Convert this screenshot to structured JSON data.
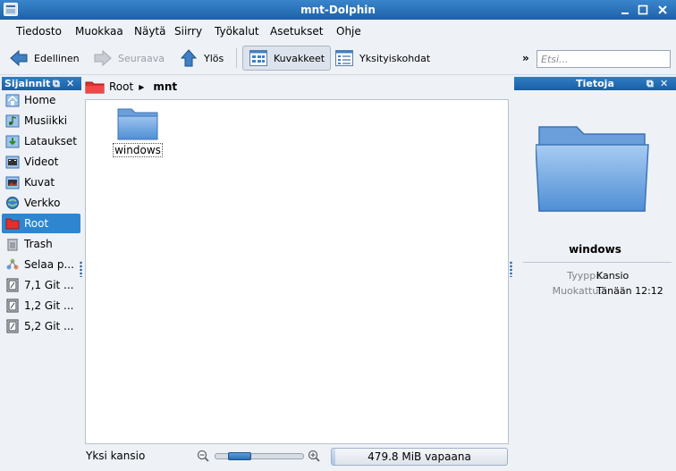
{
  "window": {
    "title": "mnt-Dolphin"
  },
  "menu": [
    "Tiedosto",
    "Muokkaa",
    "Näytä",
    "Siirry",
    "Työkalut",
    "Asetukset",
    "Ohje"
  ],
  "toolbar": {
    "back": "Edellinen",
    "forward": "Seuraava",
    "up": "Ylös",
    "icons_view": "Kuvakkeet",
    "details_view": "Yksityiskohdat",
    "more": "»",
    "search_placeholder": "Etsi..."
  },
  "places": {
    "title": "Sijainnit",
    "items": [
      {
        "label": "Home",
        "icon": "home-icon"
      },
      {
        "label": "Musiikki",
        "icon": "music-icon"
      },
      {
        "label": "Lataukset",
        "icon": "downloads-icon"
      },
      {
        "label": "Videot",
        "icon": "videos-icon"
      },
      {
        "label": "Kuvat",
        "icon": "pictures-icon"
      },
      {
        "label": "Verkko",
        "icon": "network-icon"
      },
      {
        "label": "Root",
        "icon": "root-folder-icon",
        "selected": true
      },
      {
        "label": "Trash",
        "icon": "trash-icon"
      },
      {
        "label": "Selaa p...",
        "icon": "browse-network-icon"
      },
      {
        "label": "7,1 Git ...",
        "icon": "drive-icon"
      },
      {
        "label": "1,2 Git ...",
        "icon": "drive-icon"
      },
      {
        "label": "5,2 Git ...",
        "icon": "drive-icon"
      }
    ]
  },
  "breadcrumb": {
    "root": "Root",
    "current": "mnt"
  },
  "files": [
    {
      "name": "windows"
    }
  ],
  "status": {
    "text": "Yksi kansio",
    "free_space": "479.8 MiB vapaana",
    "used_fraction": 0.02
  },
  "info": {
    "title": "Tietoja",
    "name": "windows",
    "type_label": "Tyyppi:",
    "type_value": "Kansio",
    "modified_label": "Muokattu:",
    "modified_value": "Tänään 12:12"
  },
  "colors": {
    "accent": "#2e86d0",
    "titlebar": "#1e62a8"
  }
}
